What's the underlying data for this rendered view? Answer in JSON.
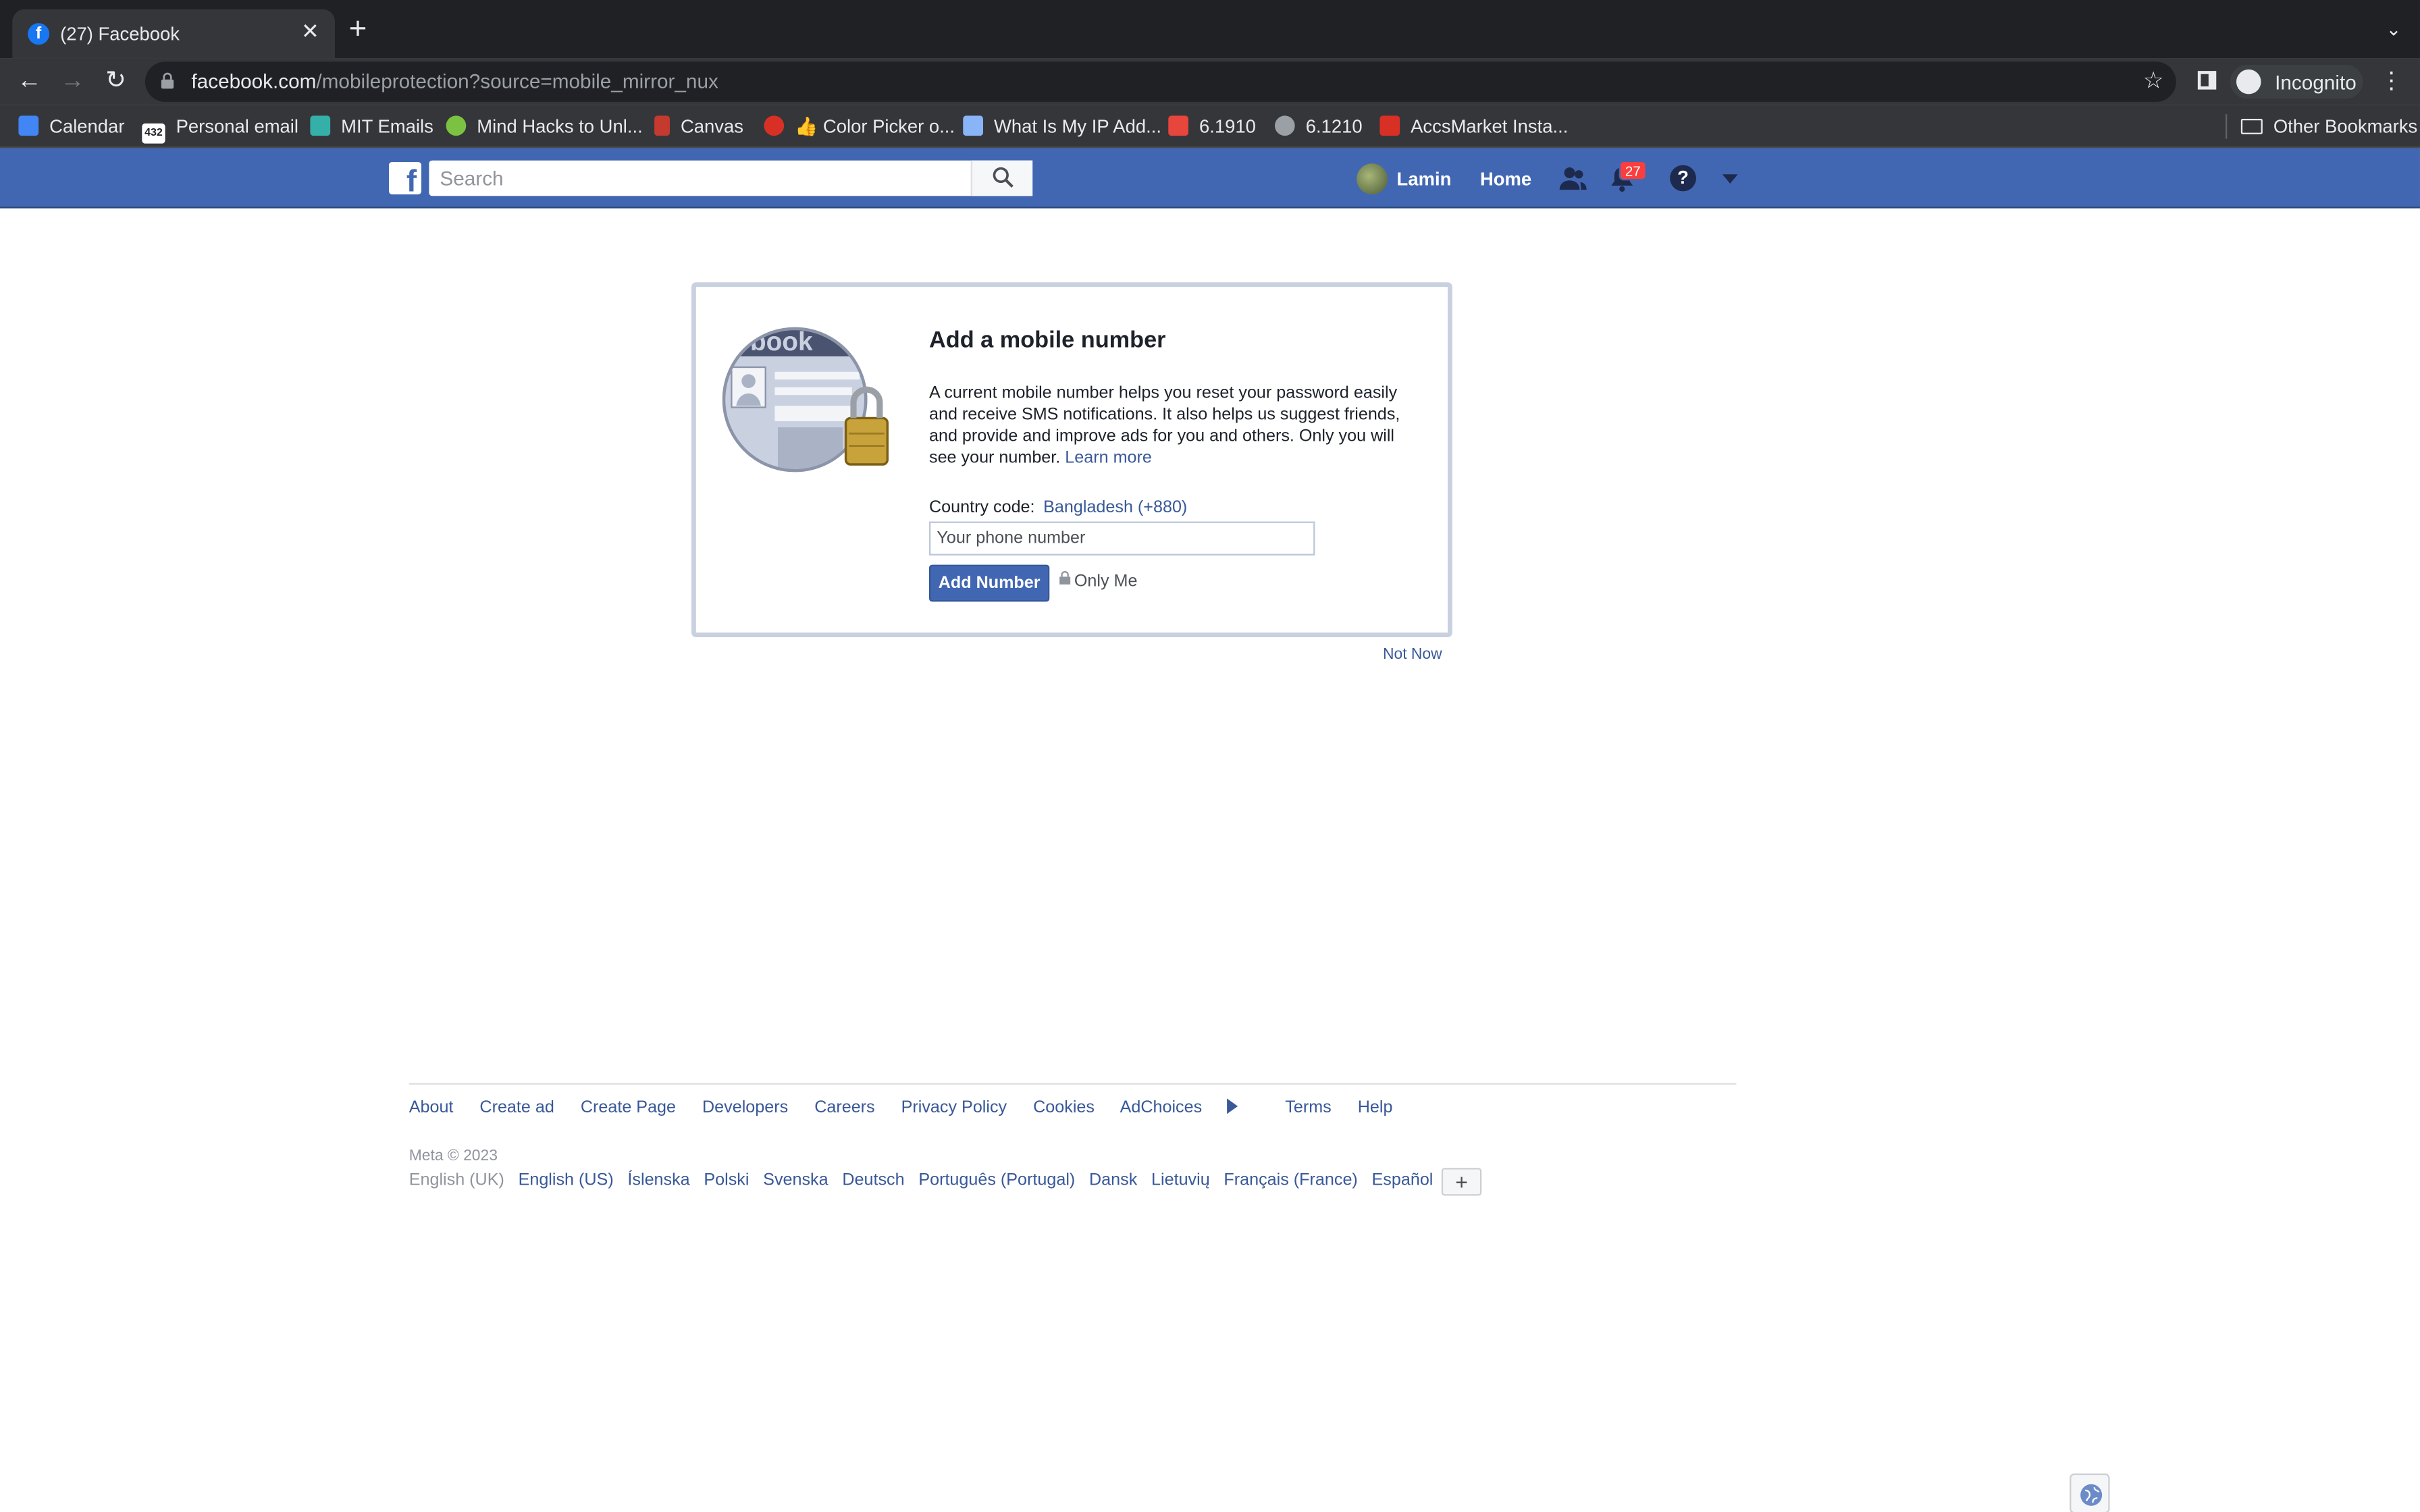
{
  "browser": {
    "tab_title": "(27) Facebook",
    "url_host": "facebook.com",
    "url_path": "/mobileprotection?source=mobile_mirror_nux",
    "profile_label": "Incognito",
    "bookmarks": [
      "Calendar",
      "Personal email",
      "MIT Emails",
      "Mind Hacks to Unl...",
      "Canvas",
      "👍 Color Picker o...",
      "What Is My IP Add...",
      "6.1910",
      "6.1210",
      "AccsMarket Insta..."
    ],
    "other_bookmarks": "Other Bookmarks",
    "bookmark_badge": "432"
  },
  "fb_header": {
    "search_placeholder": "Search",
    "user_name": "Lamin",
    "home_label": "Home",
    "notification_count": "27",
    "help_glyph": "?"
  },
  "card": {
    "title": "Add a mobile number",
    "body": "A current mobile number helps you reset your password easily and receive SMS notifications. It also helps us suggest friends, and provide and improve ads for you and others. Only you will see your number.",
    "learn_more": "Learn more",
    "country_code_label": "Country code:",
    "country_code_value": "Bangladesh (+880)",
    "phone_placeholder": "Your phone number",
    "add_button": "Add Number",
    "privacy_label": "Only Me",
    "illustration_text": "book"
  },
  "not_now": "Not Now",
  "footer": {
    "links": [
      "About",
      "Create ad",
      "Create Page",
      "Developers",
      "Careers",
      "Privacy Policy",
      "Cookies",
      "AdChoices",
      "Terms",
      "Help"
    ],
    "copyright": "Meta © 2023",
    "current_language": "English (UK)",
    "languages": [
      "English (US)",
      "Íslenska",
      "Polski",
      "Svenska",
      "Deutsch",
      "Português (Portugal)",
      "Dansk",
      "Lietuvių",
      "Français (France)",
      "Español"
    ],
    "more_languages": "+"
  },
  "colors": {
    "fb_blue": "#4267b2",
    "link": "#385898",
    "badge_red": "#fa3e3e"
  }
}
